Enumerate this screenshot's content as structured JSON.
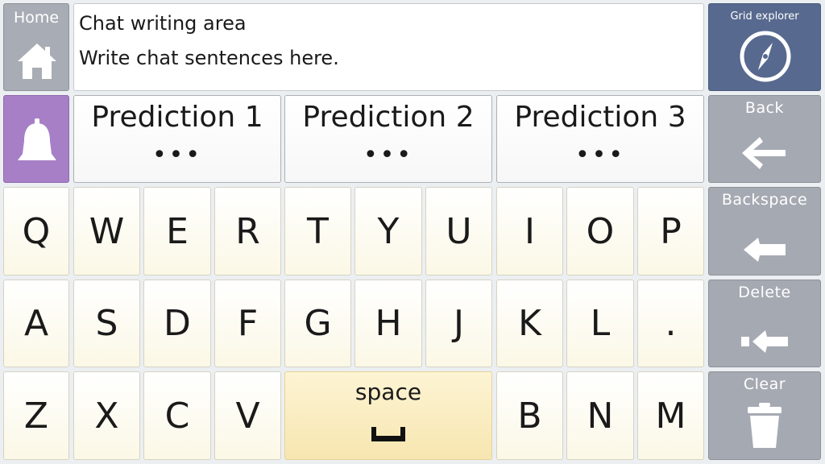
{
  "home": {
    "label": "Home",
    "icon": "home-icon"
  },
  "chat": {
    "title": "Chat writing area",
    "placeholder": "Write chat sentences here."
  },
  "grid_explorer": {
    "label": "Grid explorer",
    "icon": "compass-icon"
  },
  "bell": {
    "icon": "bell-icon",
    "color": "#a77fc6"
  },
  "predictions": [
    {
      "label": "Prediction 1",
      "dots": "•••"
    },
    {
      "label": "Prediction 2",
      "dots": "•••"
    },
    {
      "label": "Prediction 3",
      "dots": "•••"
    }
  ],
  "side": {
    "back": {
      "label": "Back",
      "icon": "arrow-left-icon"
    },
    "backspace": {
      "label": "Backspace",
      "icon": "backspace-arrow-icon"
    },
    "delete": {
      "label": "Delete",
      "icon": "delete-arrow-icon"
    },
    "clear": {
      "label": "Clear",
      "icon": "trash-icon"
    }
  },
  "keys": {
    "row1": [
      "Q",
      "W",
      "E",
      "R",
      "T",
      "Y",
      "U",
      "I",
      "O",
      "P"
    ],
    "row2": [
      "A",
      "S",
      "D",
      "F",
      "G",
      "H",
      "J",
      "K",
      "L",
      "."
    ],
    "row3_left": [
      "Z",
      "X",
      "C",
      "V"
    ],
    "row3_right": [
      "B",
      "N",
      "M"
    ]
  },
  "space": {
    "label": "space",
    "icon": "space-bar-icon"
  },
  "colors": {
    "side_gray": "#a5a9b2",
    "explorer_blue": "#57698e",
    "bell_purple": "#a77fc6",
    "key_cream": "#fbf8e6"
  }
}
